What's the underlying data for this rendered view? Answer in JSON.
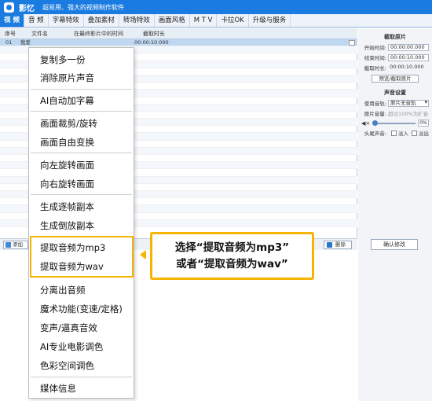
{
  "app": {
    "name": "影忆",
    "subtitle": "超易用、强大的视频制作软件"
  },
  "tabs": [
    {
      "label": "视  频",
      "active": true
    },
    {
      "label": "音  频",
      "active": false
    },
    {
      "label": "字幕特效",
      "active": false
    },
    {
      "label": "叠加素材",
      "active": false
    },
    {
      "label": "转场特效",
      "active": false
    },
    {
      "label": "画面风格",
      "active": false
    },
    {
      "label": "M T V",
      "active": false
    },
    {
      "label": "卡拉OK",
      "active": false
    },
    {
      "label": "升级与服务",
      "active": false
    }
  ],
  "table": {
    "headers": [
      "序号",
      "文件名",
      "在最终影片中的时间",
      "截取时长"
    ],
    "selected_row": {
      "index": "01",
      "name": "我爱",
      "time": "00:00:10.000"
    }
  },
  "toolbar": {
    "add_label": "添加",
    "delete_label": "删除"
  },
  "right_panel": {
    "clip_title": "截取原片",
    "start_label": "开始时间:",
    "start_value": "00:00:00.000",
    "end_label": "结束时间:",
    "end_value": "00:00:10.000",
    "duration_label": "截取时长:",
    "duration_value": "00:00:10.000",
    "preview_button": "预览/截取原片",
    "sound_title": "声音设置",
    "track_label": "使用音轨:",
    "track_value": "原片无音轨",
    "volume_label": "原片音量:",
    "volume_note": "超过100%为扩音",
    "volume_pct": "0%",
    "fade_label": "头尾声音:",
    "fade_in": "淡入",
    "fade_out": "淡出",
    "confirm_button": "确认修改"
  },
  "context_menu": {
    "items": [
      "复制多一份",
      "消除原片声音",
      "AI自动加字幕",
      "画面裁剪/旋转",
      "画面自由变换",
      "向左旋转画面",
      "向右旋转画面",
      "生成逐帧副本",
      "生成倒放副本",
      "提取音频为mp3",
      "提取音频为wav",
      "分离出音频",
      "魔术功能(变速/定格)",
      "变声/逼真音效",
      "AI专业电影调色",
      "色彩空间调色",
      "媒体信息"
    ]
  },
  "annotation": {
    "line1": "选择“提取音频为mp3”",
    "line2": "或者“提取音频为wav”"
  },
  "colors": {
    "brand_blue": "#1a7be0",
    "highlight_yellow": "#f5b400"
  }
}
